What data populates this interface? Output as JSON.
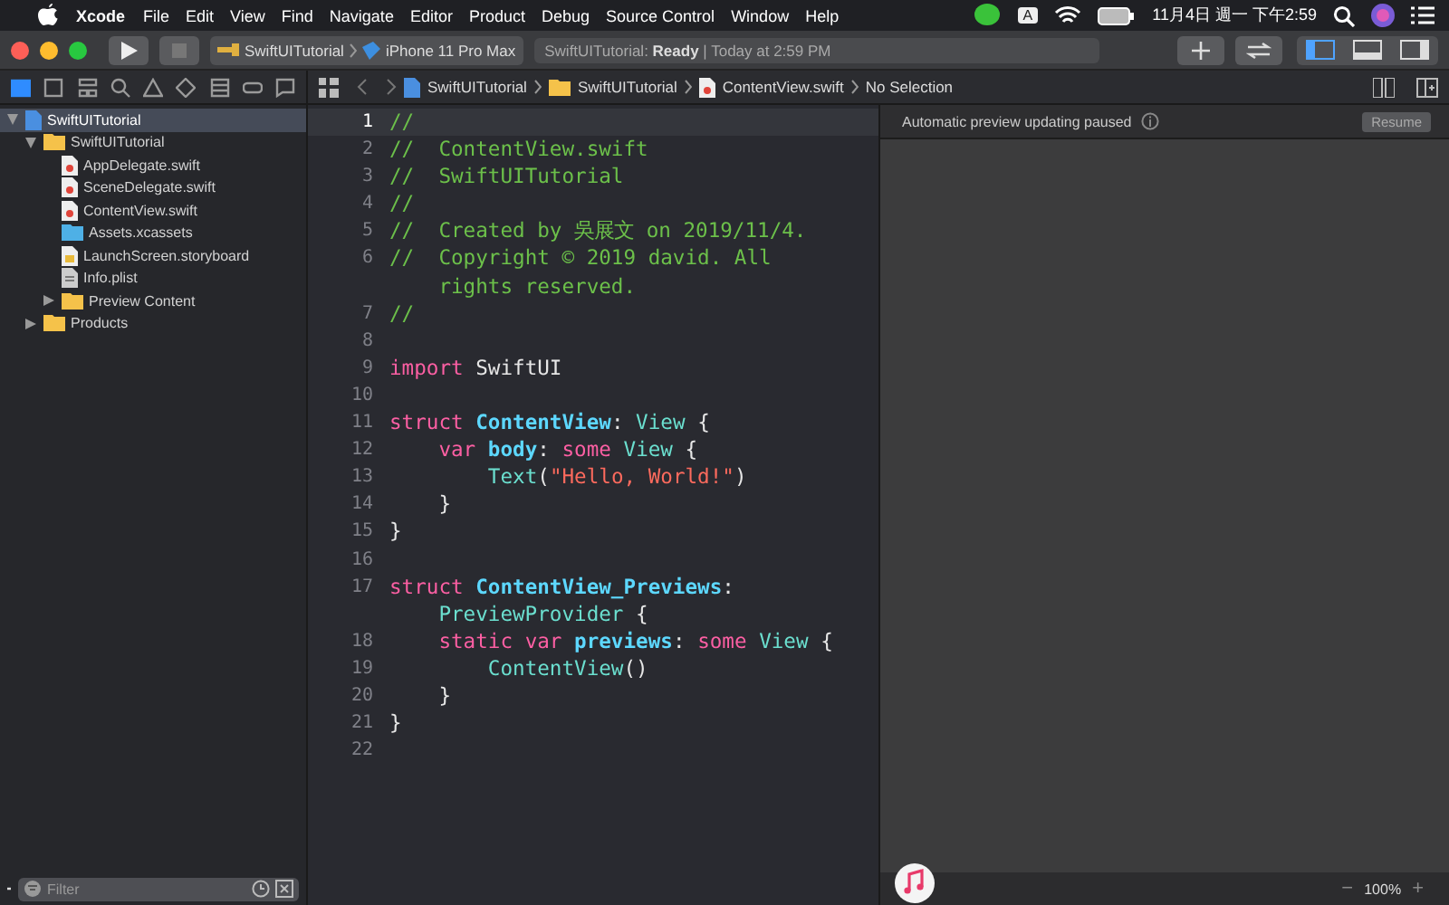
{
  "menu_bar": {
    "app": "Xcode",
    "menus": [
      "File",
      "Edit",
      "View",
      "Find",
      "Navigate",
      "Editor",
      "Product",
      "Debug",
      "Source Control",
      "Window",
      "Help"
    ],
    "input_source": "A",
    "clock": "11月4日 週一 下午2:59"
  },
  "toolbar": {
    "scheme": "SwiftUITutorial",
    "device": "iPhone 11 Pro Max",
    "activity": "SwiftUITutorial: **Ready** | Today at 2:59 PM",
    "panels": [
      {
        "kind": "navigator",
        "selected": true
      },
      {
        "kind": "debug",
        "selected": false
      },
      {
        "kind": "inspector",
        "selected": false
      }
    ]
  },
  "navigator_tabs": [
    {
      "kind": "project",
      "selected": true
    },
    {
      "kind": "source-control",
      "selected": false
    },
    {
      "kind": "symbol",
      "selected": false
    },
    {
      "kind": "find",
      "selected": false
    },
    {
      "kind": "issue",
      "selected": false
    },
    {
      "kind": "test",
      "selected": false
    },
    {
      "kind": "debug",
      "selected": false
    },
    {
      "kind": "breakpoint",
      "selected": false
    },
    {
      "kind": "report",
      "selected": false
    }
  ],
  "sidebar": {
    "items": [
      {
        "label": "SwiftUITutorial",
        "kind": "project",
        "expanded": true,
        "selected": true,
        "children": [
          {
            "label": "SwiftUITutorial",
            "kind": "folder",
            "expanded": true,
            "selected": false,
            "children": [
              {
                "label": "AppDelegate.swift",
                "kind": "swift",
                "selected": false
              },
              {
                "label": "SceneDelegate.swift",
                "kind": "swift",
                "selected": false
              },
              {
                "label": "ContentView.swift",
                "kind": "swift",
                "selected": false
              },
              {
                "label": "Assets.xcassets",
                "kind": "assets",
                "selected": false
              },
              {
                "label": "LaunchScreen.storyboard",
                "kind": "storyboard",
                "selected": false
              },
              {
                "label": "Info.plist",
                "kind": "plist",
                "selected": false
              },
              {
                "label": "Preview Content",
                "kind": "folder",
                "expanded": false,
                "selected": false
              }
            ]
          },
          {
            "label": "Products",
            "kind": "folder",
            "expanded": false,
            "selected": false
          }
        ]
      }
    ],
    "filter": {
      "placeholder": "Filter"
    }
  },
  "jump_bar": [
    {
      "label": "SwiftUITutorial",
      "kind": "project"
    },
    {
      "label": "SwiftUITutorial",
      "kind": "folder"
    },
    {
      "label": "ContentView.swift",
      "kind": "swift"
    },
    {
      "label": "No Selection",
      "kind": "none"
    }
  ],
  "editor": {
    "lines": [
      {
        "number": "1",
        "selected": true,
        "tokens": [
          {
            "kind": "comment",
            "text": "//"
          }
        ]
      },
      {
        "number": "2",
        "selected": false,
        "tokens": [
          {
            "kind": "comment",
            "text": "//  ContentView.swift"
          }
        ]
      },
      {
        "number": "3",
        "selected": false,
        "tokens": [
          {
            "kind": "comment",
            "text": "//  SwiftUITutorial"
          }
        ]
      },
      {
        "number": "4",
        "selected": false,
        "tokens": [
          {
            "kind": "comment",
            "text": "//"
          }
        ]
      },
      {
        "number": "5",
        "selected": false,
        "tokens": [
          {
            "kind": "comment",
            "text": "//  Created by 吳展文 on 2019/11/4."
          }
        ]
      },
      {
        "number": "6",
        "selected": false,
        "tokens": [
          {
            "kind": "comment",
            "text": "//  Copyright © 2019 david. All"
          }
        ],
        "wrap": [
          {
            "kind": "comment",
            "text": "rights reserved."
          }
        ]
      },
      {
        "number": "7",
        "selected": false,
        "tokens": [
          {
            "kind": "comment",
            "text": "//"
          }
        ]
      },
      {
        "number": "8",
        "selected": false
      },
      {
        "number": "9",
        "selected": false,
        "tokens": [
          {
            "kind": "keyword",
            "text": "import"
          },
          {
            "kind": "plain",
            "text": " SwiftUI"
          }
        ]
      },
      {
        "number": "10",
        "selected": false
      },
      {
        "number": "11",
        "selected": false,
        "tokens": [
          {
            "kind": "keyword",
            "text": "struct "
          },
          {
            "kind": "declaration",
            "text": "ContentView"
          },
          {
            "kind": "plain",
            "text": ": "
          },
          {
            "kind": "type",
            "text": "View "
          },
          {
            "kind": "plain",
            "text": "{"
          }
        ]
      },
      {
        "number": "12",
        "selected": false,
        "tokens": [
          {
            "kind": "keyword",
            "text": "    var "
          },
          {
            "kind": "declaration",
            "text": "body"
          },
          {
            "kind": "plain",
            "text": ": "
          },
          {
            "kind": "keyword",
            "text": "some "
          },
          {
            "kind": "type",
            "text": "View "
          },
          {
            "kind": "plain",
            "text": "{"
          }
        ]
      },
      {
        "number": "13",
        "selected": false,
        "tokens": [
          {
            "kind": "type",
            "text": "        Text"
          },
          {
            "kind": "plain",
            "text": "("
          },
          {
            "kind": "string",
            "text": "\"Hello, World!\""
          },
          {
            "kind": "plain",
            "text": ")"
          }
        ]
      },
      {
        "number": "14",
        "selected": false,
        "tokens": [
          {
            "kind": "plain",
            "text": "    }"
          }
        ]
      },
      {
        "number": "15",
        "selected": false,
        "tokens": [
          {
            "kind": "plain",
            "text": "}"
          }
        ]
      },
      {
        "number": "16",
        "selected": false
      },
      {
        "number": "17",
        "selected": false,
        "tokens": [
          {
            "kind": "keyword",
            "text": "struct "
          },
          {
            "kind": "declaration",
            "text": "ContentView_Previews"
          },
          {
            "kind": "plain",
            "text": ":"
          }
        ],
        "wrap": [
          {
            "kind": "type",
            "text": "PreviewProvider "
          },
          {
            "kind": "plain",
            "text": "{"
          }
        ]
      },
      {
        "number": "18",
        "selected": false,
        "tokens": [
          {
            "kind": "keyword",
            "text": "    static var "
          },
          {
            "kind": "declaration",
            "text": "previews"
          },
          {
            "kind": "plain",
            "text": ": "
          },
          {
            "kind": "keyword",
            "text": "some "
          },
          {
            "kind": "type",
            "text": "View "
          },
          {
            "kind": "plain",
            "text": "{"
          }
        ]
      },
      {
        "number": "19",
        "selected": false,
        "tokens": [
          {
            "kind": "type",
            "text": "        ContentView"
          },
          {
            "kind": "plain",
            "text": "()"
          }
        ]
      },
      {
        "number": "20",
        "selected": false,
        "tokens": [
          {
            "kind": "plain",
            "text": "    }"
          }
        ]
      },
      {
        "number": "21",
        "selected": false,
        "tokens": [
          {
            "kind": "plain",
            "text": "}"
          }
        ]
      },
      {
        "number": "22",
        "selected": false
      }
    ]
  },
  "preview": {
    "message": "Automatic preview updating paused",
    "button": "Resume",
    "zoom": "100%",
    "zoom_out": "−",
    "zoom_in": "+"
  }
}
